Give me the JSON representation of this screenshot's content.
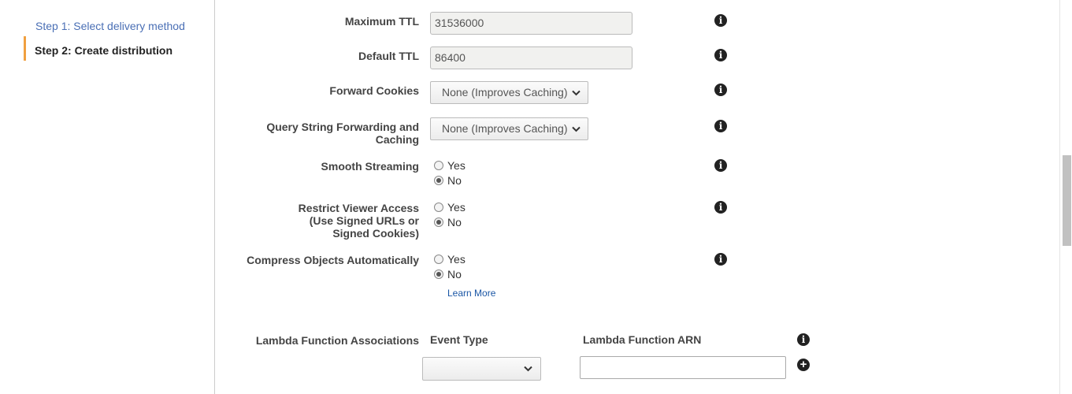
{
  "sidebar": {
    "step1_label": "Step 1: Select delivery method",
    "step2_label": "Step 2: Create distribution"
  },
  "form": {
    "max_ttl": {
      "label": "Maximum TTL",
      "value": "31536000"
    },
    "default_ttl": {
      "label": "Default TTL",
      "value": "86400"
    },
    "forward_cookies": {
      "label": "Forward Cookies",
      "selected": "None (Improves Caching)"
    },
    "query_string": {
      "label": "Query String Forwarding and Caching",
      "selected": "None (Improves Caching)"
    },
    "smooth_streaming": {
      "label": "Smooth Streaming",
      "yes": "Yes",
      "no": "No",
      "value": "No"
    },
    "restrict_viewer": {
      "label": "Restrict Viewer Access (Use Signed URLs or Signed Cookies)",
      "yes": "Yes",
      "no": "No",
      "value": "No"
    },
    "compress": {
      "label": "Compress Objects Automatically",
      "yes": "Yes",
      "no": "No",
      "value": "No"
    },
    "learn_more": "Learn More",
    "lambda": {
      "label": "Lambda Function Associations",
      "event_type_header": "Event Type",
      "arn_header": "Lambda Function ARN",
      "event_type_selected": "",
      "arn_value": ""
    }
  },
  "icons": {
    "info": "info-icon",
    "add": "plus-icon",
    "dropdown": "chevron-down-icon"
  },
  "colors": {
    "step_link": "#4a6fb5",
    "active_step_accent": "#f0a040",
    "link": "#1a56a5"
  }
}
